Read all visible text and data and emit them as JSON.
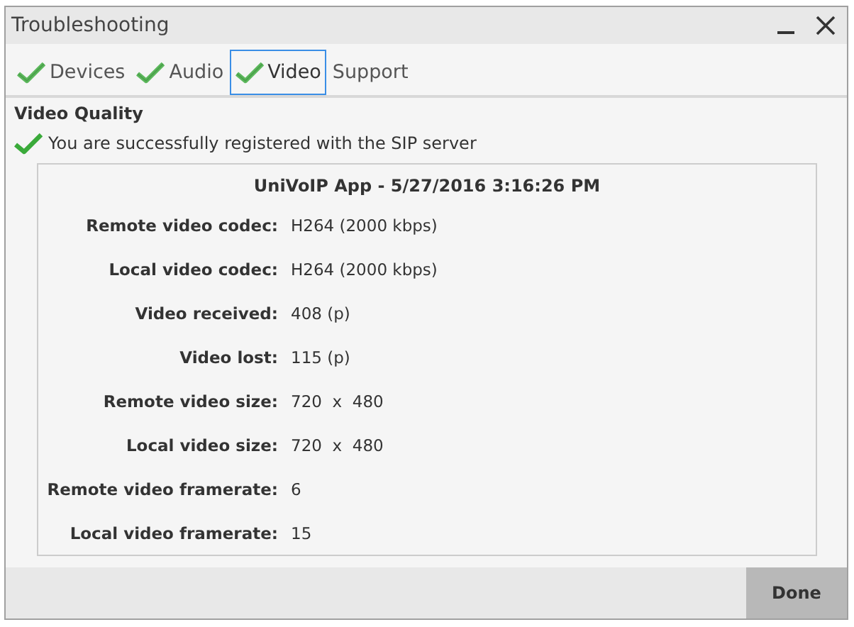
{
  "window": {
    "title": "Troubleshooting"
  },
  "tabs": [
    {
      "label": "Devices",
      "checked": true,
      "selected": false
    },
    {
      "label": "Audio",
      "checked": true,
      "selected": false
    },
    {
      "label": "Video",
      "checked": true,
      "selected": true
    },
    {
      "label": "Support",
      "checked": false,
      "selected": false
    }
  ],
  "section_title": "Video Quality",
  "status": {
    "text": "You are successfully registered with the SIP server",
    "checked": true
  },
  "report": {
    "heading": "UniVoIP App - 5/27/2016 3:16:26 PM",
    "rows": [
      {
        "label": "Remote video codec:",
        "value": "H264 (2000 kbps)"
      },
      {
        "label": "Local video codec:",
        "value": "H264 (2000 kbps)"
      },
      {
        "label": "Video received:",
        "value": "408 (p)"
      },
      {
        "label": "Video lost:",
        "value": "115 (p)"
      },
      {
        "label": "Remote video size:",
        "value": "720  x  480"
      },
      {
        "label": "Local video size:",
        "value": "720  x  480"
      },
      {
        "label": "Remote video framerate:",
        "value": "6"
      },
      {
        "label": "Local video framerate:",
        "value": "15"
      }
    ]
  },
  "buttons": [
    "Done"
  ]
}
